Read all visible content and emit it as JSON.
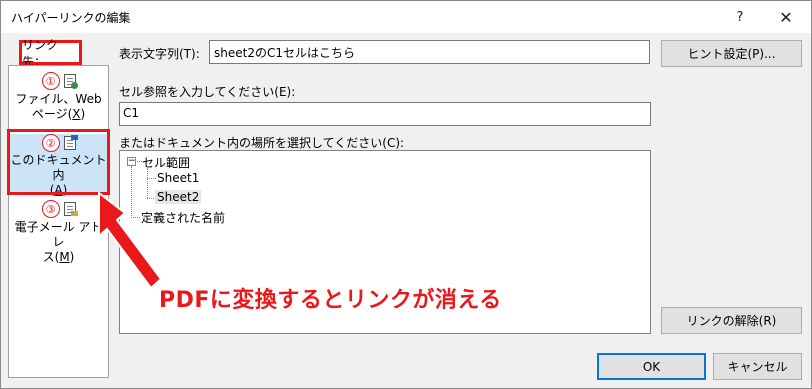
{
  "dialog": {
    "title": "ハイパーリンクの編集",
    "help_label": "?",
    "close_label": "✕"
  },
  "link_to": {
    "label": "リンク先："
  },
  "nav": {
    "items": [
      {
        "badge": "①",
        "label_line1": "ファイル、Web",
        "label_line2": "ページ(",
        "mnemonic": "X",
        "label_suffix": ")",
        "icon": "web-page-icon"
      },
      {
        "badge": "②",
        "label_line1": "このドキュメント内",
        "label_line2": "(",
        "mnemonic": "A",
        "label_suffix": ")",
        "icon": "this-document-icon",
        "selected": true
      },
      {
        "badge": "③",
        "label_line1": "電子メール アドレ",
        "label_line2": "ス(",
        "mnemonic": "M",
        "label_suffix": ")",
        "icon": "email-icon"
      }
    ]
  },
  "display_text": {
    "label": "表示文字列(T):",
    "value": "sheet2のC1セルはこちら"
  },
  "hint_button": {
    "label": "ヒント設定(P)..."
  },
  "cell_ref": {
    "label": "セル参照を入力してください(E):",
    "value": "C1"
  },
  "place_select": {
    "label": "またはドキュメント内の場所を選択してください(C):",
    "tree": {
      "root": "セル範囲",
      "children": [
        "Sheet1",
        "Sheet2"
      ],
      "selected": "Sheet2",
      "names_node": "定義された名前",
      "expander_symbol": "−"
    }
  },
  "remove_button": {
    "label": "リンクの解除(R)"
  },
  "ok_button": {
    "label": "OK"
  },
  "cancel_button": {
    "label": "キャンセル"
  },
  "annotation": {
    "text": "PDFに変換するとリンクが消える",
    "color": "#e8181b"
  },
  "colors": {
    "accent_red": "#e8181b",
    "selected_bg": "#cce4f7",
    "ok_border": "#0078d7"
  }
}
